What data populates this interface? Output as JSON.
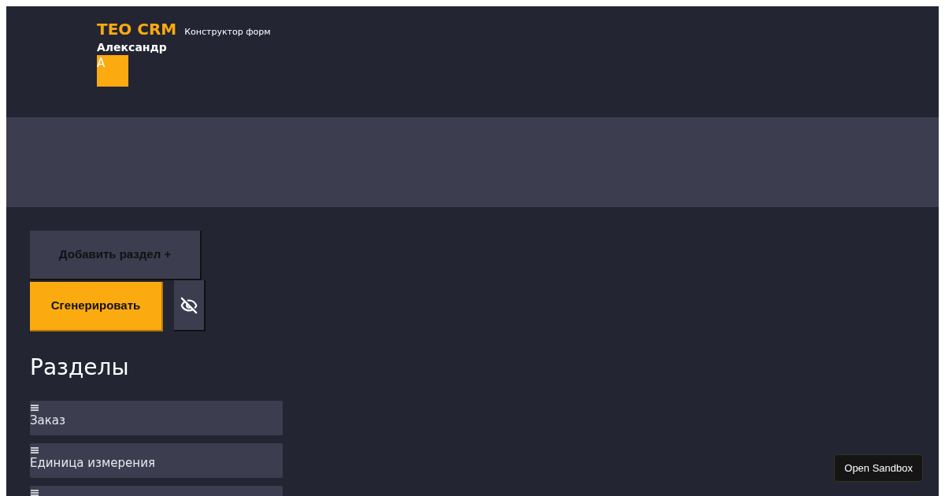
{
  "header": {
    "brand": "TEO CRM",
    "subtitle": "Конструктор форм",
    "user_name": "Александр",
    "avatar_letter": "А"
  },
  "actions": {
    "add_section": "Добавить раздел",
    "add_icon": "+",
    "generate": "Сгенерировать"
  },
  "sections_title": "Разделы",
  "sections": [
    {
      "kind": "full",
      "label": "Заказ"
    },
    {
      "kind": "full",
      "label": "Единица измерения"
    },
    {
      "kind": "cut_off"
    }
  ],
  "sandbox_button": "Open Sandbox"
}
